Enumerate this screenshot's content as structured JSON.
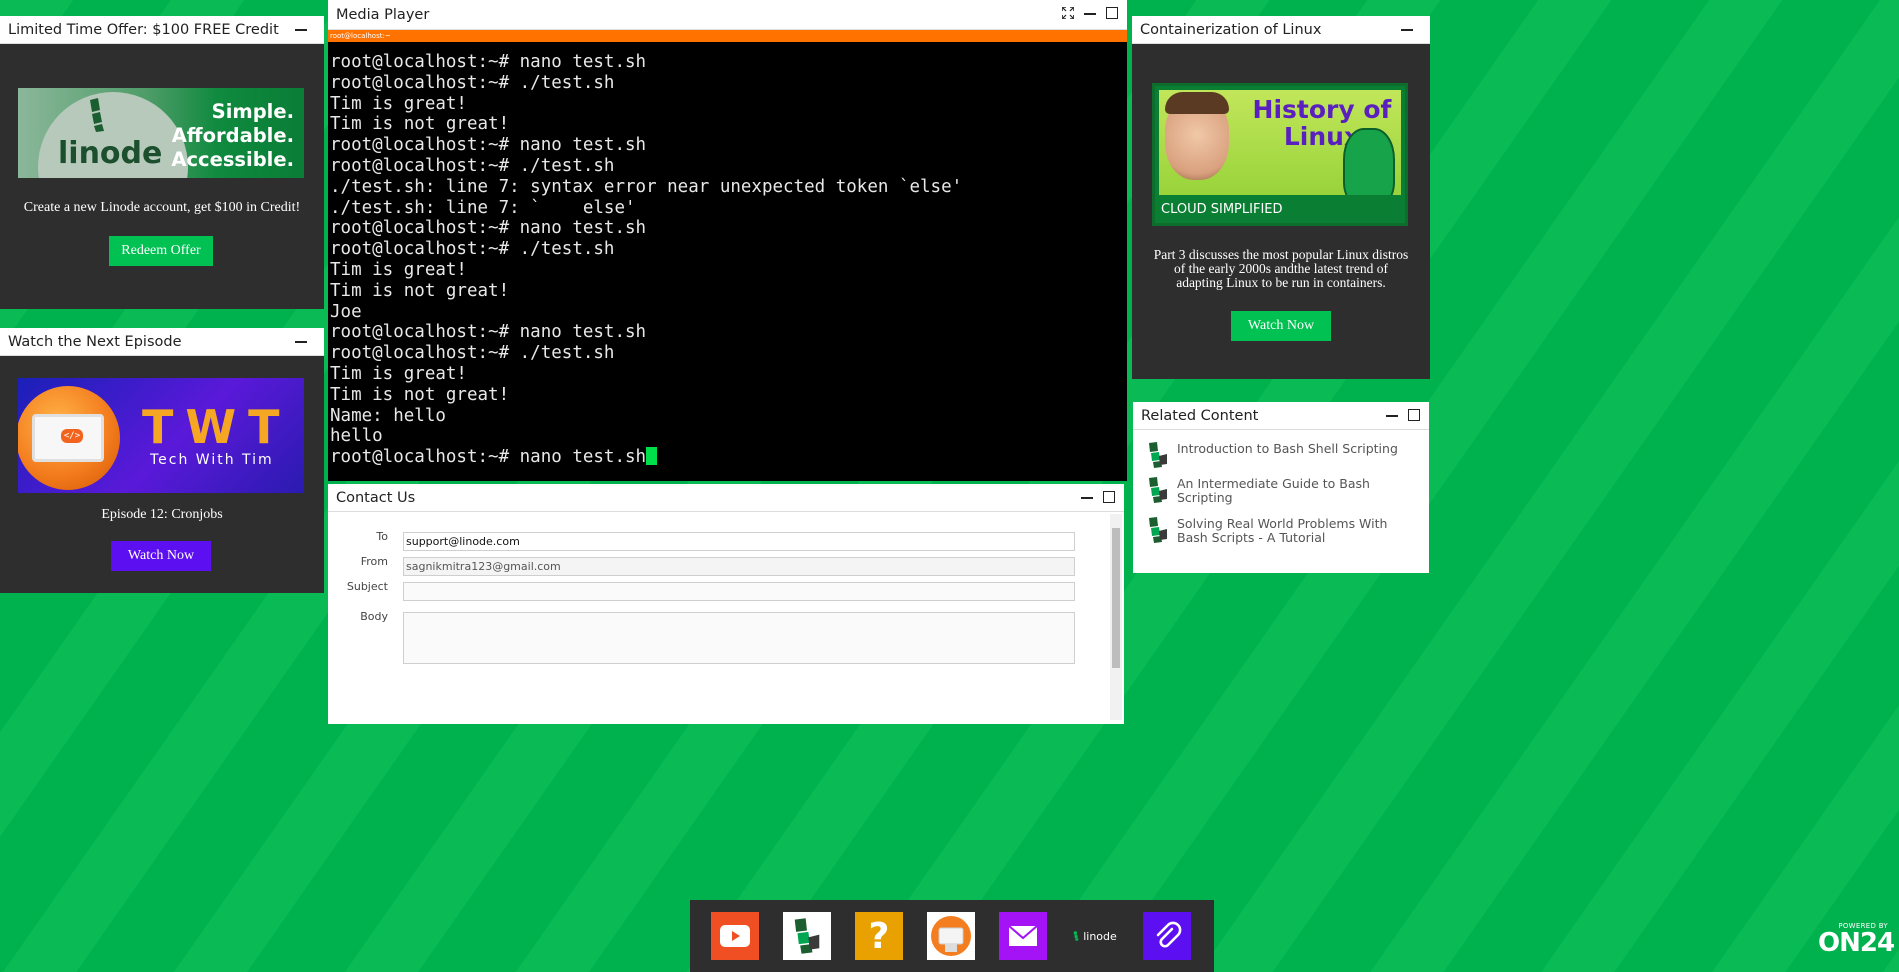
{
  "offer": {
    "title": "Limited Time Offer: $100 FREE Credit",
    "banner_logo": "linode",
    "banner_lines": [
      "Simple.",
      "Affordable.",
      "Accessible."
    ],
    "text": "Create a new Linode account, get $100 in Credit!",
    "button": "Redeem Offer"
  },
  "episode": {
    "title": "Watch the Next Episode",
    "banner_letters": "TWT",
    "banner_sub": "Tech With Tim",
    "banner_code": "</>",
    "episode_title": "Episode 12: Cronjobs",
    "button": "Watch Now"
  },
  "media": {
    "title": "Media Player",
    "terminal_tab": "root@localhost:~",
    "lines": [
      "root@localhost:~# nano test.sh",
      "root@localhost:~# ./test.sh",
      "Tim is great!",
      "Tim is not great!",
      "root@localhost:~# nano test.sh",
      "root@localhost:~# ./test.sh",
      "./test.sh: line 7: syntax error near unexpected token `else'",
      "./test.sh: line 7: `    else'",
      "root@localhost:~# nano test.sh",
      "root@localhost:~# ./test.sh",
      "Tim is great!",
      "Tim is not great!",
      "Joe",
      "root@localhost:~# nano test.sh",
      "root@localhost:~# ./test.sh",
      "Tim is great!",
      "Tim is not great!",
      "Name: hello",
      "hello"
    ],
    "last_line": "root@localhost:~# nano test.sh"
  },
  "contact": {
    "title": "Contact Us",
    "to_label": "To",
    "to_value": "support@linode.com",
    "from_label": "From",
    "from_value": "sagnikmitra123@gmail.com",
    "subject_label": "Subject",
    "subject_value": "",
    "body_label": "Body",
    "body_value": ""
  },
  "linux": {
    "title": "Containerization of Linux",
    "banner_title": "History of Linux",
    "banner_strip": "CLOUD SIMPLIFIED",
    "description": "Part 3 discusses the most popular Linux distros of the early 2000s andthe latest trend of adapting Linux to be run in containers.",
    "button": "Watch Now"
  },
  "related": {
    "title": "Related Content",
    "items": [
      "Introduction to Bash Shell Scripting",
      "An Intermediate Guide to Bash Scripting",
      "Solving Real World Problems With Bash Scripts - A Tutorial"
    ]
  },
  "dock": {
    "items": [
      "play-icon",
      "linode-icon",
      "help-icon",
      "tim-avatar-icon",
      "mail-icon",
      "linode-logo-icon",
      "attachment-icon"
    ],
    "linode_text": "linode",
    "help_glyph": "?"
  },
  "branding": {
    "powered_by": "POWERED BY",
    "logo": "ON24"
  },
  "colors": {
    "background": "#00b84f",
    "panel": "#2e2e2e",
    "accent_green": "#00c152",
    "accent_purple": "#5c0ff0",
    "terminal_bar": "#ff7200",
    "cursor": "#00e04a"
  }
}
